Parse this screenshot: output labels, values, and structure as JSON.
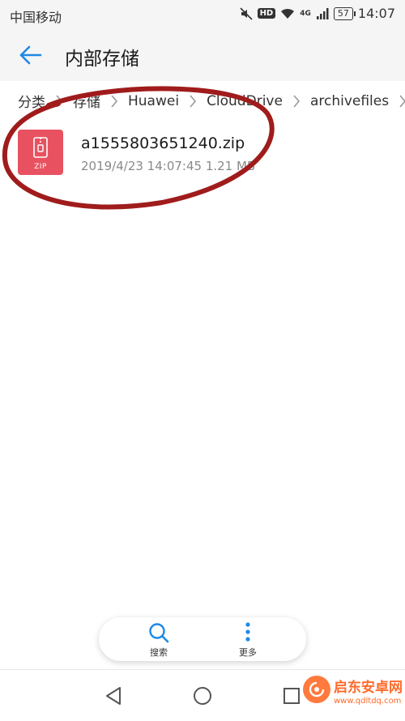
{
  "status_bar": {
    "carrier": "中国移动",
    "hd_label": "HD",
    "network_label": "4G",
    "battery": "57",
    "time": "14:07"
  },
  "header": {
    "title": "内部存储"
  },
  "breadcrumb": {
    "items": [
      "分类",
      "存储",
      "Huawei",
      "CloudDrive",
      "archivefiles"
    ]
  },
  "files": [
    {
      "icon_label": "ZIP",
      "name": "a1555803651240.zip",
      "meta": "2019/4/23 14:07:45 1.21 MB"
    }
  ],
  "toolbar": {
    "search_label": "搜索",
    "more_label": "更多"
  },
  "watermark": {
    "text": "启东安卓网",
    "url": "www.qdltdq.com"
  },
  "colors": {
    "accent": "#1e88e5",
    "zip_icon": "#e85260",
    "annotation": "#a01c1c",
    "watermark": "#ff6a2a"
  }
}
